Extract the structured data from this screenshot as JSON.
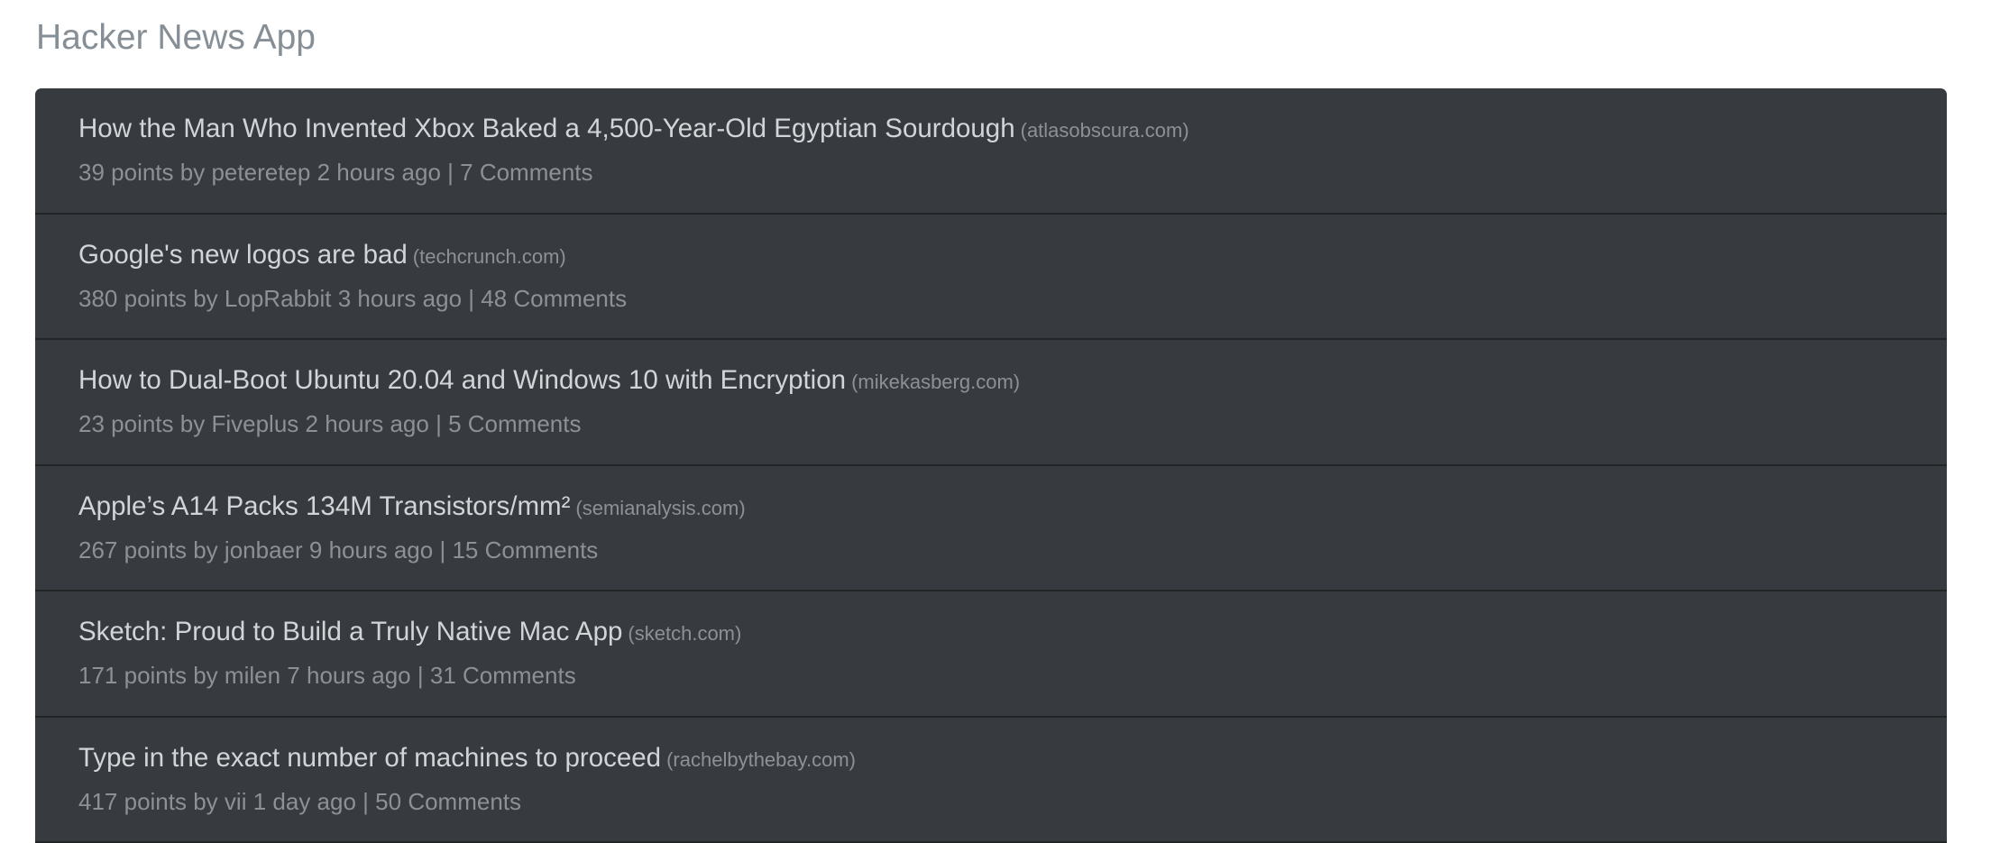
{
  "app": {
    "title": "Hacker News App"
  },
  "stories": [
    {
      "title": "How the Man Who Invented Xbox Baked a 4,500-Year-Old Egyptian Sourdough",
      "domain": "(atlasobscura.com)",
      "points": "39 points",
      "by": "by",
      "author": "peteretep",
      "age": "2 hours ago",
      "separator": "|",
      "comments": "7 Comments"
    },
    {
      "title": "Google's new logos are bad",
      "domain": "(techcrunch.com)",
      "points": "380 points",
      "by": "by",
      "author": "LopRabbit",
      "age": "3 hours ago",
      "separator": "|",
      "comments": "48 Comments"
    },
    {
      "title": "How to Dual-Boot Ubuntu 20.04 and Windows 10 with Encryption",
      "domain": "(mikekasberg.com)",
      "points": "23 points",
      "by": "by",
      "author": "Fiveplus",
      "age": "2 hours ago",
      "separator": "|",
      "comments": "5 Comments"
    },
    {
      "title": "Apple’s A14 Packs 134M Transistors/mm²",
      "domain": "(semianalysis.com)",
      "points": "267 points",
      "by": "by",
      "author": "jonbaer",
      "age": "9 hours ago",
      "separator": "|",
      "comments": "15 Comments"
    },
    {
      "title": "Sketch: Proud to Build a Truly Native Mac App",
      "domain": "(sketch.com)",
      "points": "171 points",
      "by": "by",
      "author": "milen",
      "age": "7 hours ago",
      "separator": "|",
      "comments": "31 Comments"
    },
    {
      "title": "Type in the exact number of machines to proceed",
      "domain": "(rachelbythebay.com)",
      "points": "417 points",
      "by": "by",
      "author": "vii",
      "age": "1 day ago",
      "separator": "|",
      "comments": "50 Comments"
    }
  ],
  "colors": {
    "panel_bg": "#373a3e",
    "divider": "#222426",
    "title_text": "#d2d5d8",
    "muted_text": "#8d9196",
    "app_title": "#868e96"
  }
}
